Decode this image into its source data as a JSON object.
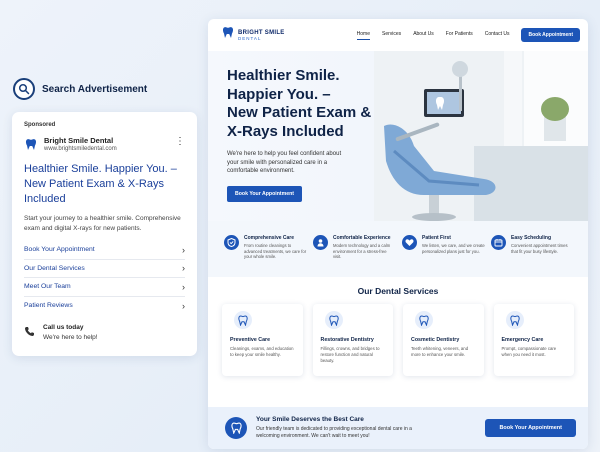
{
  "search_ad": {
    "heading": "Search Advertisement",
    "sponsored": "Sponsored",
    "advertiser_name": "Bright Smile Dental",
    "advertiser_url": "www.brightsmiledental.com",
    "headline": "Healthier Smile. Happier You. – New Patient Exam & X-Rays Included",
    "description": "Start your journey to a healthier smile. Comprehensive exam and digital X-rays for new patients.",
    "sitelinks": [
      {
        "label": "Book Your Appointment"
      },
      {
        "label": "Our Dental Services"
      },
      {
        "label": "Meet Our Team"
      },
      {
        "label": "Patient Reviews"
      }
    ],
    "call_title": "Call us today",
    "call_subtitle": "We're here to help!"
  },
  "site": {
    "brand_name": "BRIGHT SMILE",
    "brand_tag": "DENTAL",
    "nav": [
      {
        "label": "Home"
      },
      {
        "label": "Services"
      },
      {
        "label": "About Us"
      },
      {
        "label": "For Patients"
      },
      {
        "label": "Contact Us"
      }
    ],
    "nav_cta": "Book Appointment",
    "hero": {
      "title_line1": "Healthier Smile.",
      "title_line2": "Happier You. –",
      "title_line3": "New Patient Exam &",
      "title_line4": "X-Rays Included",
      "subtitle": "We're here to help you feel confident about your smile with personalized care in a comfortable environment.",
      "button": "Book Your Appointment"
    },
    "features": [
      {
        "title": "Comprehensive Care",
        "desc": "From routine cleanings to advanced treatments, we care for your whole smile."
      },
      {
        "title": "Comfortable Experience",
        "desc": "Modern technology and a calm environment for a stress-free visit."
      },
      {
        "title": "Patient First",
        "desc": "We listen, we care, and we create personalized plans just for you."
      },
      {
        "title": "Easy Scheduling",
        "desc": "Convenient appointment times that fit your busy lifestyle."
      }
    ],
    "services_title": "Our Dental Services",
    "services": [
      {
        "title": "Preventive Care",
        "desc": "Cleanings, exams, and education to keep your smile healthy."
      },
      {
        "title": "Restorative Dentistry",
        "desc": "Fillings, crowns, and bridges to restore function and natural beauty."
      },
      {
        "title": "Cosmetic Dentistry",
        "desc": "Teeth whitening, veneers, and more to enhance your smile."
      },
      {
        "title": "Emergency Care",
        "desc": "Prompt, compassionate care when you need it most."
      }
    ],
    "footer": {
      "title": "Your Smile Deserves the Best Care",
      "desc": "Our friendly team is dedicated to providing exceptional dental care in a welcoming environment. We can't wait to meet you!",
      "button": "Book Your Appointment"
    }
  },
  "colors": {
    "primary": "#1d55b7",
    "heading": "#0f2347",
    "link": "#1a3f9a"
  }
}
